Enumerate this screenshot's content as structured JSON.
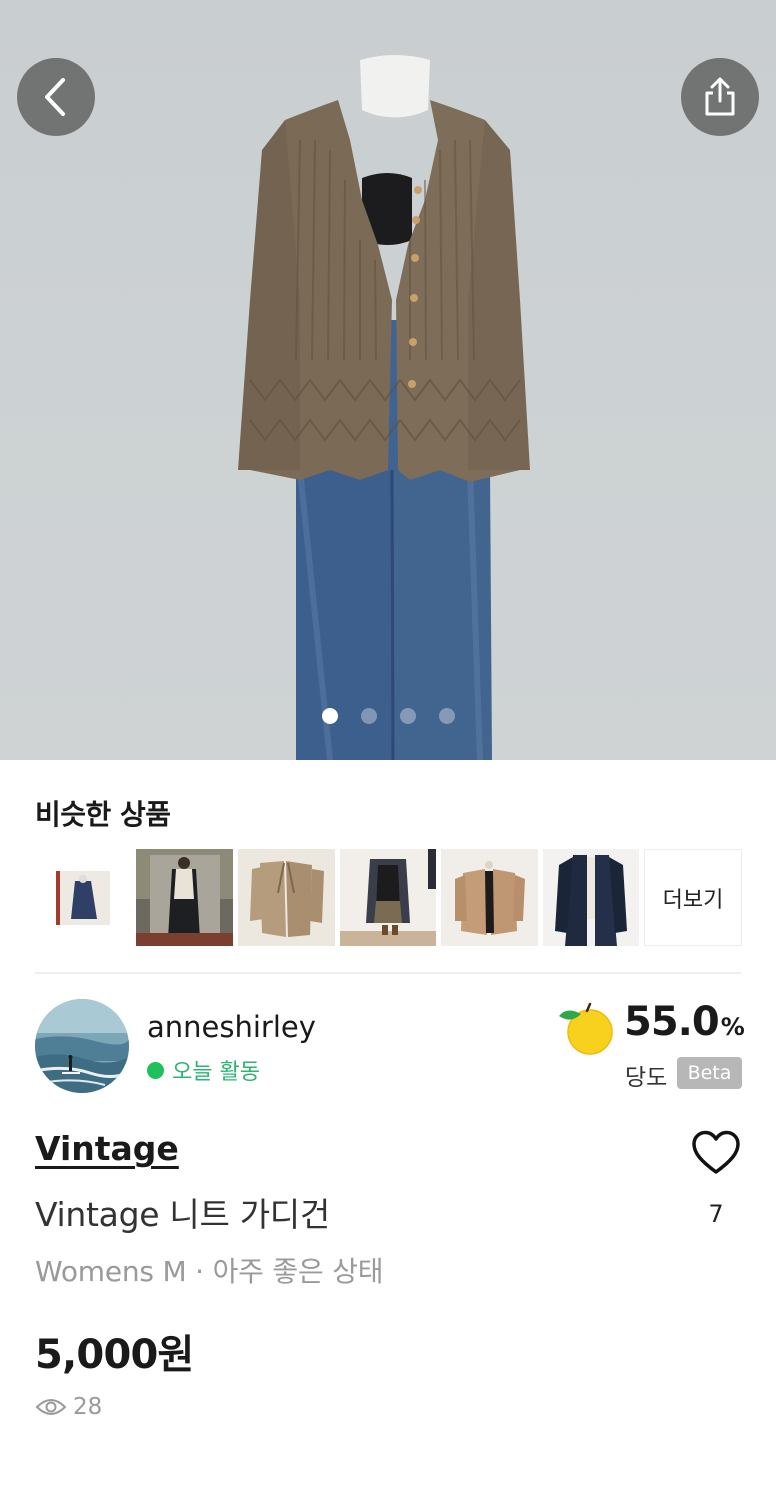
{
  "hero": {
    "image_alt": "ribbed brown knit cardigan on mannequin with blue jeans",
    "dots_total": 4,
    "dots_active_index": 0
  },
  "nav": {
    "back_icon": "chevron-left-icon",
    "share_icon": "share-icon"
  },
  "similar": {
    "title": "비슷한 상품",
    "more_label": "더보기"
  },
  "seller": {
    "name": "anneshirley",
    "activity": "오늘 활동",
    "sweetness_value": "55.0",
    "sweetness_unit": "%",
    "sweetness_label": "당도",
    "beta": "Beta"
  },
  "product": {
    "brand": "Vintage",
    "title": "Vintage 니트 가디건",
    "meta": "Womens M · 아주 좋은 상태",
    "price": "5,000원",
    "likes": "7",
    "views": "28"
  },
  "colors": {
    "activity_green": "#20c05c",
    "beta_badge": "#b7b7b7",
    "muted_text": "#9a9a9a"
  }
}
